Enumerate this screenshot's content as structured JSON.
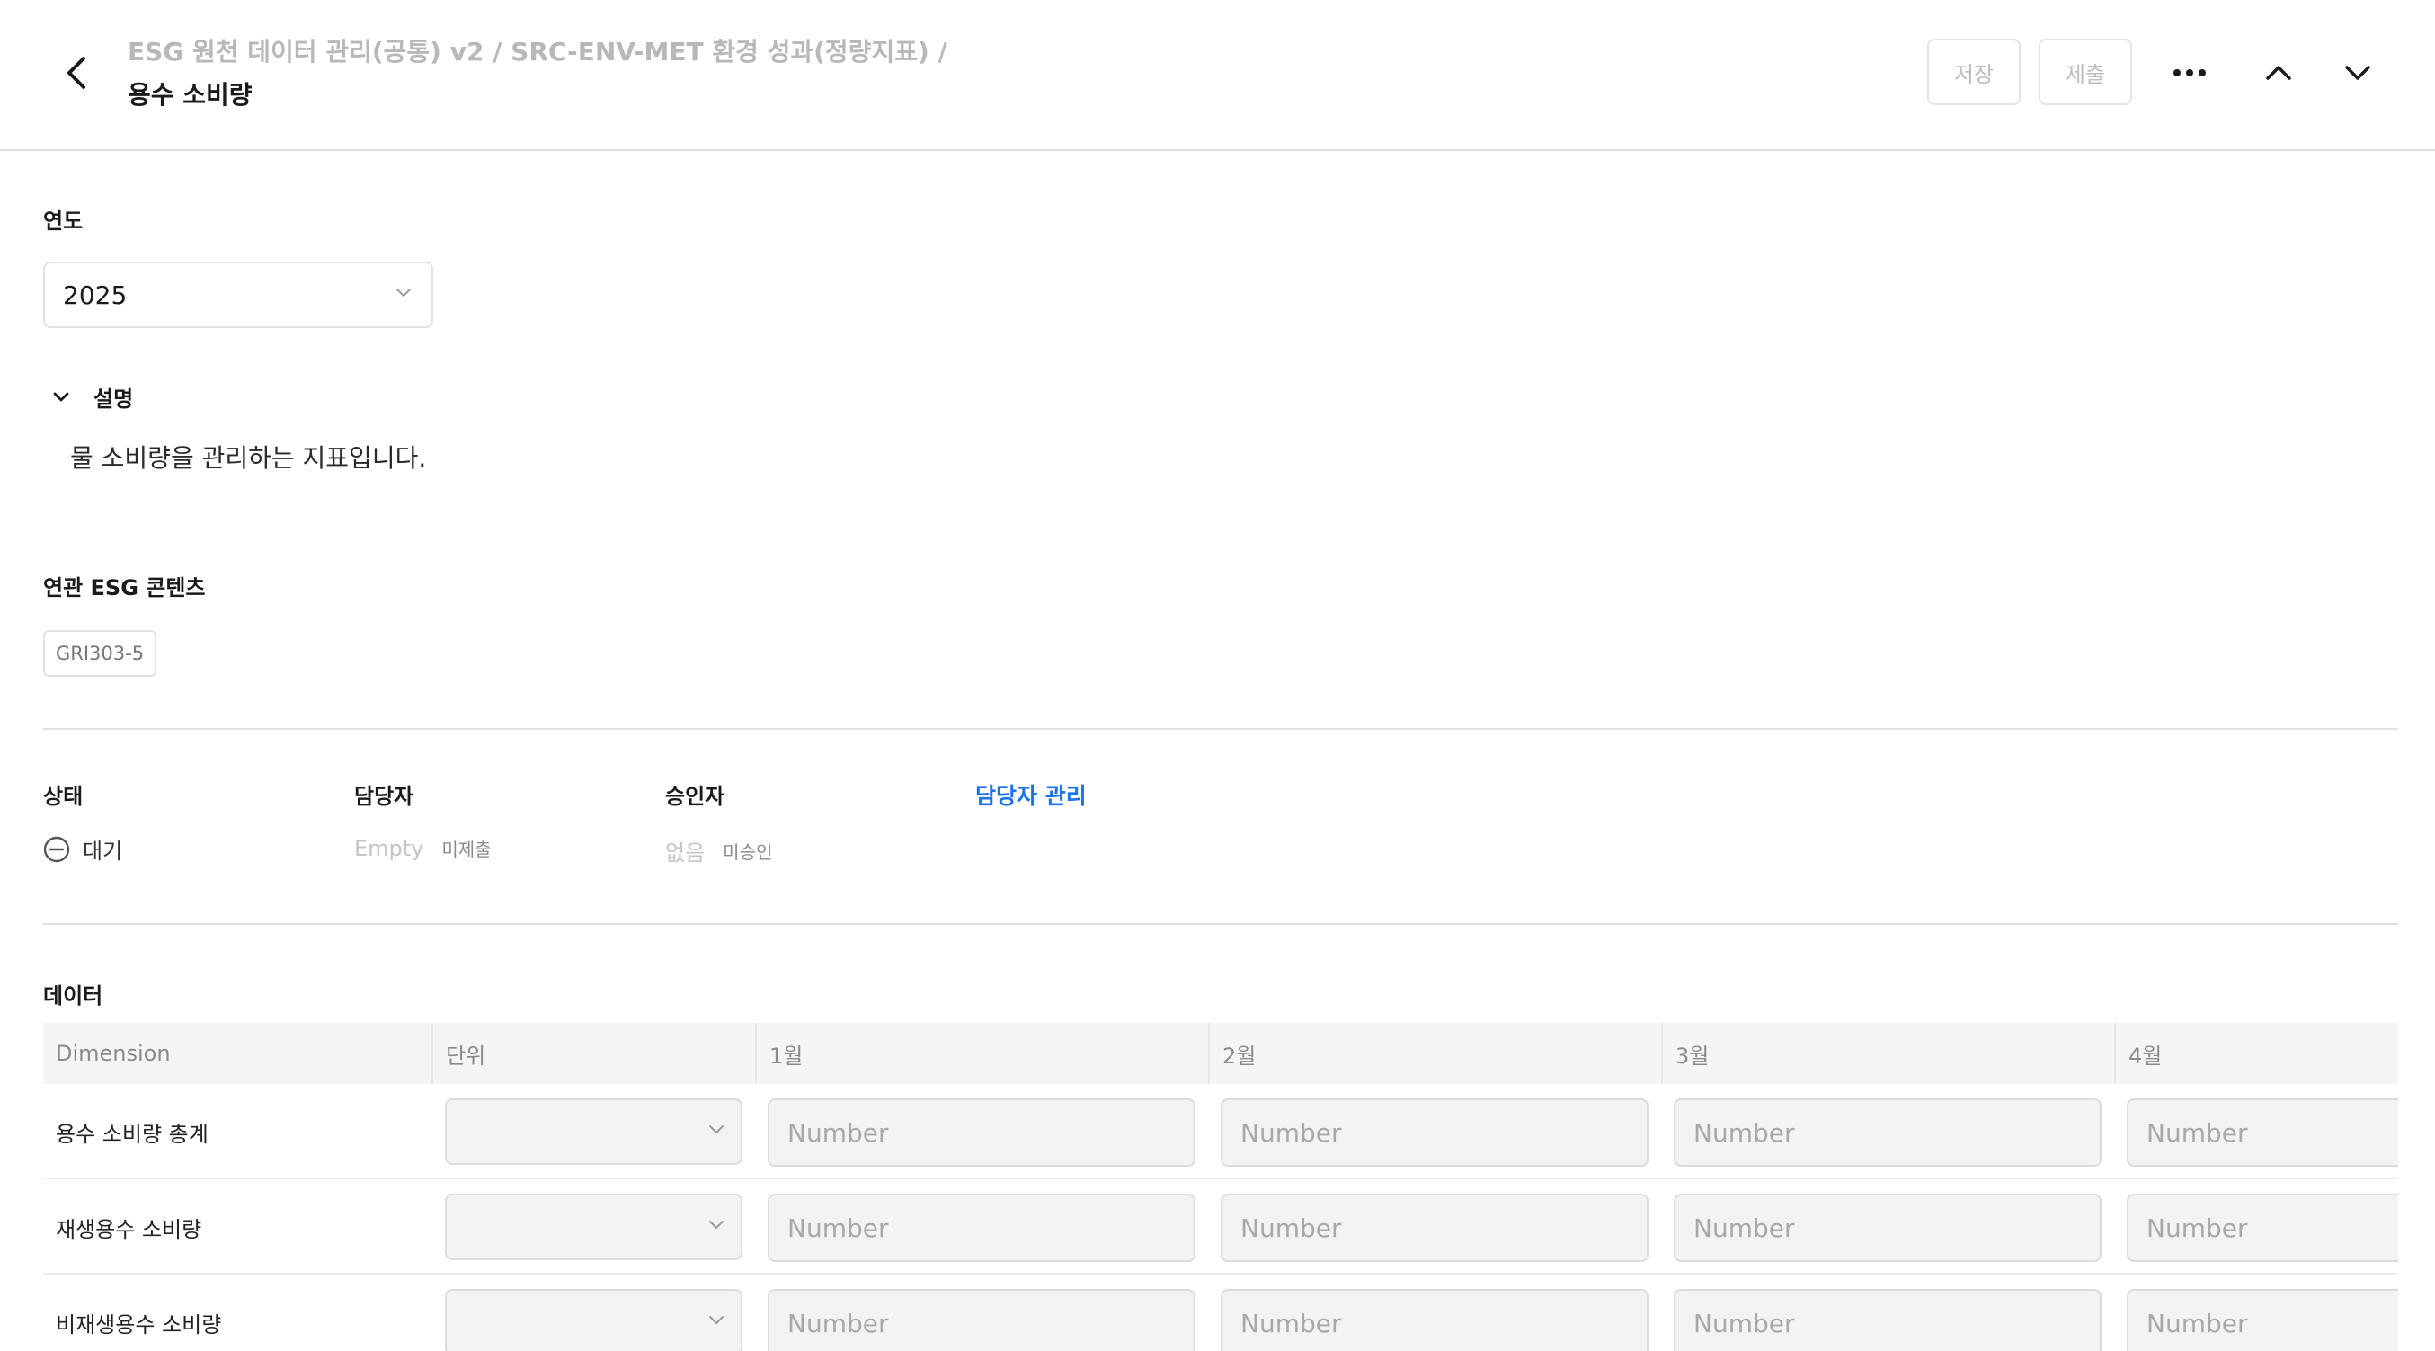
{
  "header": {
    "breadcrumb": "ESG 원천 데이터 관리(공통) v2 / SRC-ENV-MET 환경 성과(정량지표) /",
    "title": "용수 소비량",
    "save_label": "저장",
    "submit_label": "제출",
    "icons": [
      "back-arrow-icon",
      "more-icon",
      "chevron-up-icon",
      "chevron-down-icon"
    ]
  },
  "year": {
    "label": "연도",
    "value": "2025"
  },
  "description": {
    "label": "설명",
    "text": "물 소비량을 관리하는 지표입니다.",
    "expanded": true
  },
  "related": {
    "label": "연관 ESG 콘텐츠",
    "tags": [
      "GRI303-5"
    ]
  },
  "status": {
    "label": "상태",
    "value": "대기"
  },
  "assignee": {
    "label": "담당자",
    "value": "Empty",
    "state": "미제출"
  },
  "approver": {
    "label": "승인자",
    "value": "없음",
    "state": "미승인"
  },
  "manage_link": "담당자 관리",
  "data_section": {
    "label": "데이터",
    "columns": [
      "Dimension",
      "단위",
      "1월",
      "2월",
      "3월",
      "4월"
    ],
    "rows": [
      {
        "dimension": "용수 소비량 총계"
      },
      {
        "dimension": "재생용수 소비량"
      },
      {
        "dimension": "비재생용수 소비량"
      }
    ],
    "input_placeholder": "Number"
  },
  "colors": {
    "link": "#1a73e8",
    "muted": "#b8b8b8",
    "input_bg": "#f3f3f3"
  }
}
